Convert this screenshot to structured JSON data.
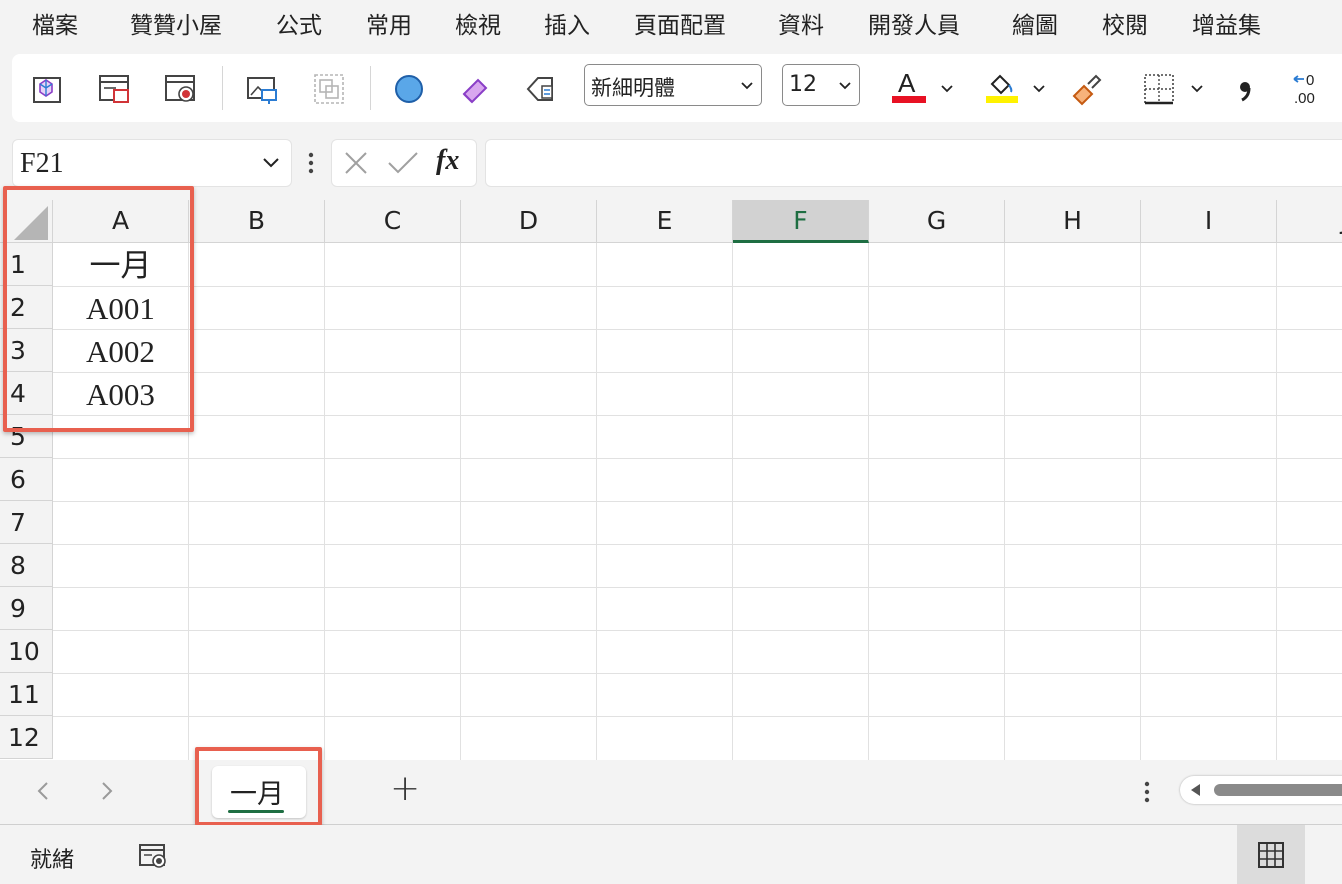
{
  "menu": [
    "檔案",
    "贊贊小屋",
    "公式",
    "常用",
    "檢視",
    "插入",
    "頁面配置",
    "資料",
    "開發人員",
    "繪圖",
    "校閱",
    "增益集"
  ],
  "ribbon": {
    "font_name": "新細明體",
    "font_size": "12",
    "font_color": "#e81123",
    "fill_color": "#fff200",
    "icons": [
      "3d-model-icon",
      "insert-table-icon",
      "record-macro-icon",
      "picture-icon",
      "group-icon",
      "shape-circle-icon",
      "eraser-icon",
      "tag-icon",
      "font-color-icon",
      "fill-color-icon",
      "format-painter-icon",
      "borders-icon",
      "comma-style-icon",
      "decrease-decimal-icon"
    ]
  },
  "formula_bar": {
    "name_box": "F21",
    "fx_label": "fx",
    "formula": ""
  },
  "grid": {
    "columns": [
      "A",
      "B",
      "C",
      "D",
      "E",
      "F",
      "G",
      "H",
      "I",
      "J"
    ],
    "active_column": "F",
    "rows": [
      "1",
      "2",
      "3",
      "4",
      "5",
      "6",
      "7",
      "8",
      "9",
      "10",
      "11",
      "12"
    ],
    "column_a_values": [
      "一月",
      "A001",
      "A002",
      "A003"
    ]
  },
  "sheets": {
    "tabs": [
      "一月"
    ],
    "active": "一月",
    "add_label": "+"
  },
  "status": {
    "text": "就緒"
  },
  "colors": {
    "accent_green": "#1e6e42",
    "highlight_red": "#e8604f"
  }
}
